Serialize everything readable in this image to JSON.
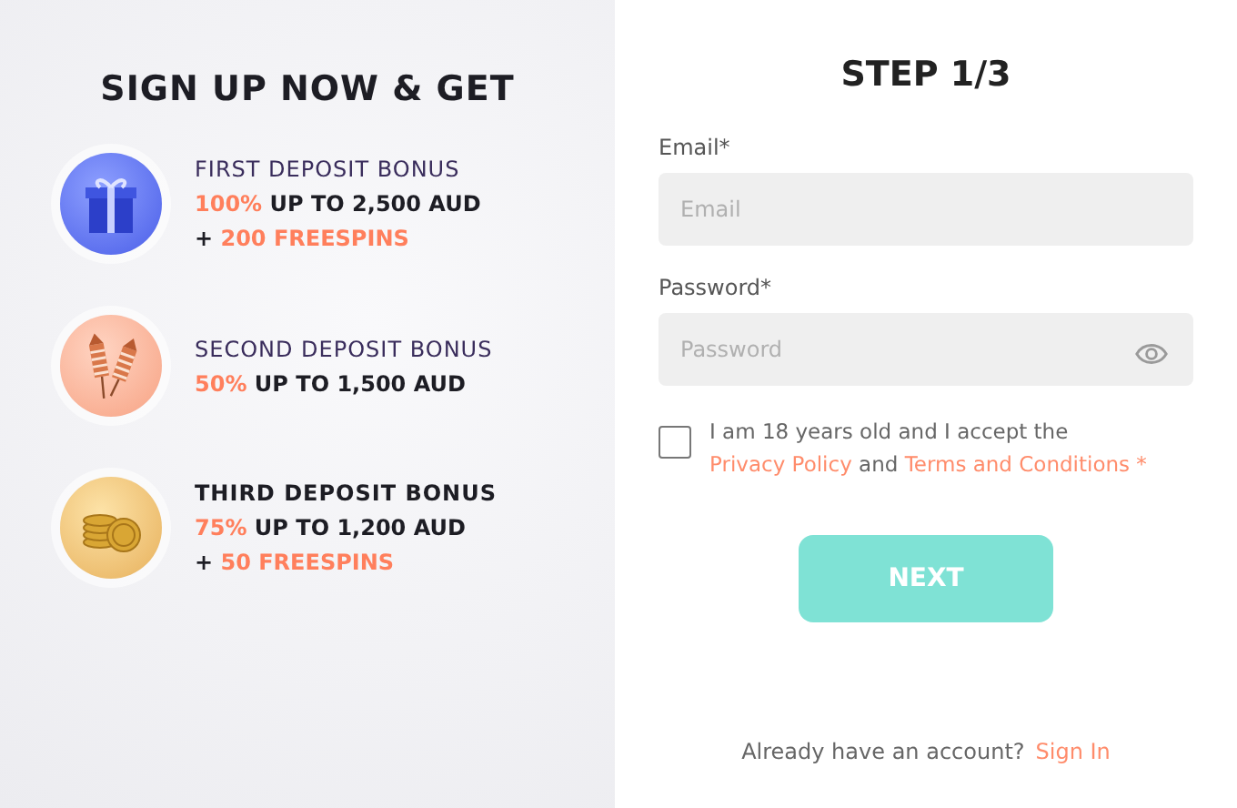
{
  "promo": {
    "heading": "SIGN UP NOW & GET",
    "bonuses": [
      {
        "kind": "gift",
        "title": "FIRST DEPOSIT BONUS",
        "title_bold": false,
        "percent": "100%",
        "amount": "UP TO 2,500 AUD",
        "extra_prefix": "+",
        "extra": "200 FREESPINS"
      },
      {
        "kind": "rockets",
        "title": "SECOND DEPOSIT BONUS",
        "title_bold": false,
        "percent": "50%",
        "amount": "UP TO 1,500 AUD"
      },
      {
        "kind": "coins",
        "title": "THIRD DEPOSIT BONUS",
        "title_bold": true,
        "percent": "75%",
        "amount": "UP TO 1,200 AUD",
        "extra_prefix": "+",
        "extra": "50 FREESPINS"
      }
    ]
  },
  "form": {
    "step": "STEP 1/3",
    "fields": [
      {
        "kind": "text",
        "label": "Email*",
        "placeholder": "Email"
      },
      {
        "kind": "password",
        "label": "Password*",
        "placeholder": "Password"
      }
    ],
    "consent": {
      "checked": false,
      "text_before": "I am 18 years old and I accept the",
      "privacy_link": "Privacy Policy",
      "text_mid": "and",
      "terms_link": "Terms and Conditions",
      "required_mark": "*"
    },
    "next_button": "NEXT",
    "signin_prompt": "Already have an account?",
    "signin_link": "Sign In"
  }
}
